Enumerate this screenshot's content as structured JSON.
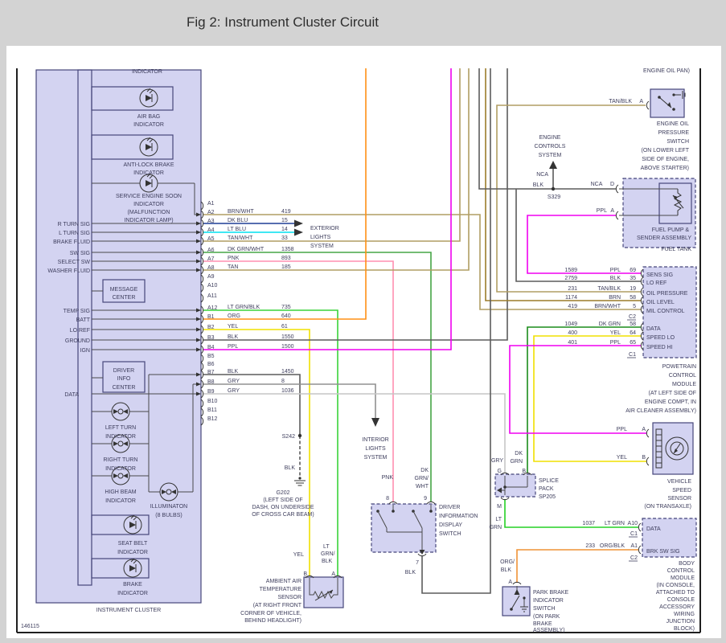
{
  "header": {
    "title": "Fig 2: Instrument Cluster Circuit"
  },
  "doc_number": "146115",
  "colors": {
    "tan": "#b19e63",
    "dk_blu": "#1f3e96",
    "lt_blu": "#00e0f0",
    "grn_wht": "#46a546",
    "pnk": "#ff8fb1",
    "lt_grn_blk": "#3ad43a",
    "org": "#ff9015",
    "yel": "#f0e000",
    "blk": "#5c5c5c",
    "ppl": "#f000f0",
    "gry": "#909090",
    "gry_lt": "#c6c6c6",
    "brn": "#9b7c2a",
    "dk_grn": "#1a8c1a",
    "lt_grn": "#25d025",
    "org_blk": "#ef9336"
  },
  "cluster": {
    "name": "INSTRUMENT CLUSTER",
    "top_indicator": "INDICATOR",
    "air_bag": [
      "AIR BAG",
      "INDICATOR"
    ],
    "abs": [
      "ANTI-LOCK BRAKE",
      "INDICATOR"
    ],
    "ses": [
      "SERVICE ENGINE SOON",
      "INDICATOR",
      "(MALFUNCTION",
      "INDICATOR LAMP)"
    ],
    "message_center": [
      "MESSAGE",
      "CENTER"
    ],
    "driver_info": [
      "DRIVER",
      "INFO",
      "CENTER"
    ],
    "left_turn": [
      "LEFT TURN",
      "INDICATOR"
    ],
    "right_turn": [
      "RIGHT TURN",
      "INDICATOR"
    ],
    "high_beam": [
      "HIGH BEAM",
      "INDICATOR"
    ],
    "illumination": [
      "ILLUMINATON",
      "(8 BULBS)"
    ],
    "seat_belt": [
      "SEAT BELT",
      "INDICATOR"
    ],
    "brake": [
      "BRAKE",
      "INDICATOR"
    ],
    "signals": [
      "R TURN SIG",
      "L TURN SIG",
      "BRAKE FLUID",
      "SW SIG",
      "SELECT SW",
      "WASHER FLUID",
      "TEMP SIG",
      "BATT",
      "LO REF",
      "GROUND",
      "IGN"
    ],
    "data_label": "DATA"
  },
  "conn": {
    "rows": [
      {
        "pin": "A1"
      },
      {
        "pin": "A2",
        "color": "BRN/WHT",
        "circuit": "419"
      },
      {
        "pin": "A3",
        "color": "DK BLU",
        "circuit": "15"
      },
      {
        "pin": "A4",
        "color": "LT BLU",
        "circuit": "14"
      },
      {
        "pin": "A5",
        "color": "TAN/WHT",
        "circuit": "33"
      },
      {
        "pin": "A6",
        "color": "DK GRN/WHT",
        "circuit": "1358"
      },
      {
        "pin": "A7",
        "color": "PNK",
        "circuit": "893"
      },
      {
        "pin": "A8",
        "color": "TAN",
        "circuit": "185"
      },
      {
        "pin": "A9"
      },
      {
        "pin": "A10"
      },
      {
        "pin": "A11"
      },
      {
        "pin": "A12",
        "color": "LT GRN/BLK",
        "circuit": "735"
      },
      {
        "pin": "B1",
        "color": "ORG",
        "circuit": "640"
      },
      {
        "pin": "B2",
        "color": "YEL",
        "circuit": "61"
      },
      {
        "pin": "B3",
        "color": "BLK",
        "circuit": "1550"
      },
      {
        "pin": "B4",
        "color": "PPL",
        "circuit": "1500"
      },
      {
        "pin": "B5"
      },
      {
        "pin": "B6"
      },
      {
        "pin": "B7",
        "color": "BLK",
        "circuit": "1450"
      },
      {
        "pin": "B8",
        "color": "GRY",
        "circuit": "8"
      },
      {
        "pin": "B9",
        "color": "GRY",
        "circuit": "1036"
      },
      {
        "pin": "B10"
      },
      {
        "pin": "B11"
      },
      {
        "pin": "B12"
      }
    ]
  },
  "systems": {
    "exterior": [
      "EXTERIOR",
      "LIGHTS",
      "SYSTEM"
    ],
    "interior": [
      "INTERIOR",
      "LIGHTS",
      "SYSTEM"
    ],
    "engine": [
      "ENGINE",
      "CONTROLS",
      "SYSTEM"
    ]
  },
  "grounds": {
    "s242": "S242",
    "s242_wire": "BLK",
    "g202": [
      "G202",
      "(LEFT SIDE OF",
      "DASH, ON UNDERSIDE",
      "OF CROSS CAR BEAM)"
    ]
  },
  "s329": {
    "name": "S329",
    "blk": "BLK",
    "nca": "NCA",
    "nca2": "NCA",
    "d": "D"
  },
  "oil_switch": {
    "header": "ENGINE OIL PAN)",
    "wire": "TAN/BLK",
    "pin": "A",
    "label": [
      "ENGINE OIL",
      "PRESSURE",
      "SWITCH",
      "(ON LOWER LEFT",
      "SIDE OF ENGINE,",
      "ABOVE STARTER)"
    ]
  },
  "fuel_pump": {
    "ppl": "PPL",
    "a": "A",
    "label": [
      "FUEL PUMP &",
      "SENDER ASSEMBLY"
    ],
    "tank": "FUEL TANK"
  },
  "pcm": {
    "rows": [
      {
        "num": "1589",
        "color": "PPL",
        "pin": "69",
        "name": "SENS SIG"
      },
      {
        "num": "2759",
        "color": "BLK",
        "pin": "35",
        "name": "LO REF"
      },
      {
        "num": "231",
        "color": "TAN/BLK",
        "pin": "19",
        "name": "OIL PRESSURE"
      },
      {
        "num": "1174",
        "color": "BRN",
        "pin": "58",
        "name": "OIL LEVEL"
      },
      {
        "num": "419",
        "color": "BRN/WHT",
        "pin": "5",
        "name": "MIL CONTROL"
      },
      {
        "num": "1049",
        "color": "DK GRN",
        "pin": "58",
        "name": "DATA"
      },
      {
        "num": "400",
        "color": "YEL",
        "pin": "64",
        "name": "SPEED LO"
      },
      {
        "num": "401",
        "color": "PPL",
        "pin": "65",
        "name": "SPEED HI"
      }
    ],
    "c2": "C2",
    "c1": "C1",
    "label": [
      "POWETRAIN",
      "CONTROL",
      "MODULE",
      "(AT LEFT SIDE OF",
      "ENGINE COMPT, IN",
      "AIR CLEANER ASSEMBLY)"
    ]
  },
  "vss": {
    "ppl": "PPL",
    "a": "A",
    "yel": "YEL",
    "b": "B",
    "label": [
      "VEHICLE",
      "SPEED",
      "SENSOR",
      "(ON TRANSAXLE)"
    ]
  },
  "sp205": {
    "gry": "GRY",
    "dk": "DK",
    "grn": "GRN",
    "g": "G",
    "b": "B",
    "m": "M",
    "lt": "LT",
    "lt2": "GRN",
    "label": [
      "SPLICE",
      "PACK",
      "SP205"
    ]
  },
  "bcm": {
    "rows": [
      {
        "num": "1037",
        "color": "LT GRN",
        "pin": "A10",
        "conn": "C1",
        "name": "DATA"
      },
      {
        "num": "233",
        "color": "ORG/BLK",
        "pin": "A1",
        "conn": "C2",
        "name": "BRK SW SIG"
      }
    ],
    "label": [
      "BODY",
      "CONTROL",
      "MODULE",
      "(IN CONSOLE,",
      "ATTACHED TO",
      "CONSOLE",
      "ACCESSORY",
      "WIRING",
      "JUNCTION",
      "BLOCK)"
    ]
  },
  "dids": {
    "pnk": "PNK",
    "dk": "DK",
    "grn": "GRN/",
    "wht": "WHT",
    "p8": "8",
    "p9": "9",
    "p7": "7",
    "blk": "BLK",
    "label": [
      "DRIVER",
      "INFORMATION",
      "DISPLAY",
      "SWITCH"
    ]
  },
  "ambient": {
    "yel": "YEL",
    "lt": "LT",
    "grn": "GRN/",
    "blk": "BLK",
    "b": "B",
    "a": "A",
    "label": [
      "AMBIENT AIR",
      "TEMPERATURE",
      "SENSOR",
      "(AT RIGHT FRONT",
      "CORNER OF VEHICLE,",
      "BEHIND HEADLIGHT)"
    ]
  },
  "park_brake": {
    "org": "ORG/",
    "blk": "BLK",
    "a": "A",
    "label": [
      "PARK BRAKE",
      "INDICATOR",
      "SWITCH",
      "(ON PARK",
      "BRAKE",
      "ASSEMBLY)"
    ]
  }
}
